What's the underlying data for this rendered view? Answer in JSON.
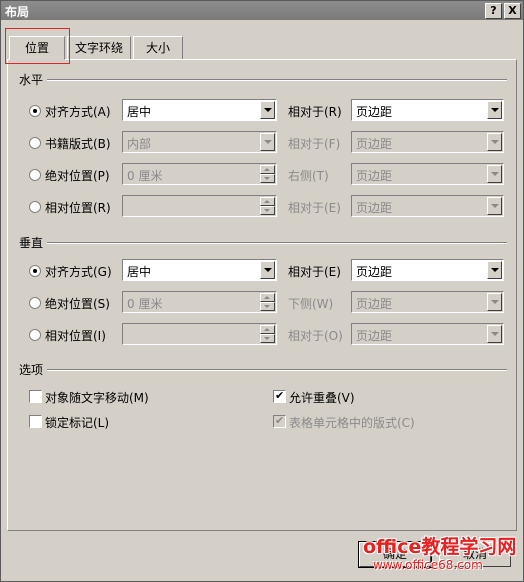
{
  "window": {
    "title": "布局",
    "help_label": "?",
    "close_label": "X"
  },
  "tabs": [
    {
      "label": "位置",
      "active": true
    },
    {
      "label": "文字环绕",
      "active": false
    },
    {
      "label": "大小",
      "active": false
    }
  ],
  "horizontal": {
    "title": "水平",
    "rows": [
      {
        "label": "对齐方式(A)",
        "selected": true,
        "enabled": true,
        "value": "居中",
        "rel_label": "相对于(R)",
        "rel_value": "页边距"
      },
      {
        "label": "书籍版式(B)",
        "selected": false,
        "enabled": false,
        "value": "内部",
        "rel_label": "相对于(F)",
        "rel_value": "页边距"
      },
      {
        "label": "绝对位置(P)",
        "selected": false,
        "enabled": false,
        "value": "0 厘米",
        "rel_label": "右侧(T)",
        "rel_value": "页边距"
      },
      {
        "label": "相对位置(R)",
        "selected": false,
        "enabled": false,
        "value": "",
        "rel_label": "相对于(E)",
        "rel_value": "页边距"
      }
    ]
  },
  "vertical": {
    "title": "垂直",
    "rows": [
      {
        "label": "对齐方式(G)",
        "selected": true,
        "enabled": true,
        "value": "居中",
        "rel_label": "相对于(E)",
        "rel_value": "页边距"
      },
      {
        "label": "绝对位置(S)",
        "selected": false,
        "enabled": false,
        "value": "0 厘米",
        "rel_label": "下侧(W)",
        "rel_value": "页边距"
      },
      {
        "label": "相对位置(I)",
        "selected": false,
        "enabled": false,
        "value": "",
        "rel_label": "相对于(O)",
        "rel_value": "页边距"
      }
    ]
  },
  "options": {
    "title": "选项",
    "move_with_text": {
      "label": "对象随文字移动(M)",
      "checked": false,
      "enabled": true
    },
    "lock_anchor": {
      "label": "锁定标记(L)",
      "checked": false,
      "enabled": true
    },
    "allow_overlap": {
      "label": "允许重叠(V)",
      "checked": true,
      "enabled": true
    },
    "layout_in_cell": {
      "label": "表格单元格中的版式(C)",
      "checked": true,
      "enabled": false
    }
  },
  "buttons": {
    "ok": "确定",
    "cancel": "取消"
  },
  "watermark": {
    "line1": "office教程学习网",
    "line2": "www.office68.com"
  },
  "colors": {
    "face": "#d4d0c8",
    "title_bar": "#808080",
    "highlight": "#e02525",
    "watermark": "#e82020"
  }
}
